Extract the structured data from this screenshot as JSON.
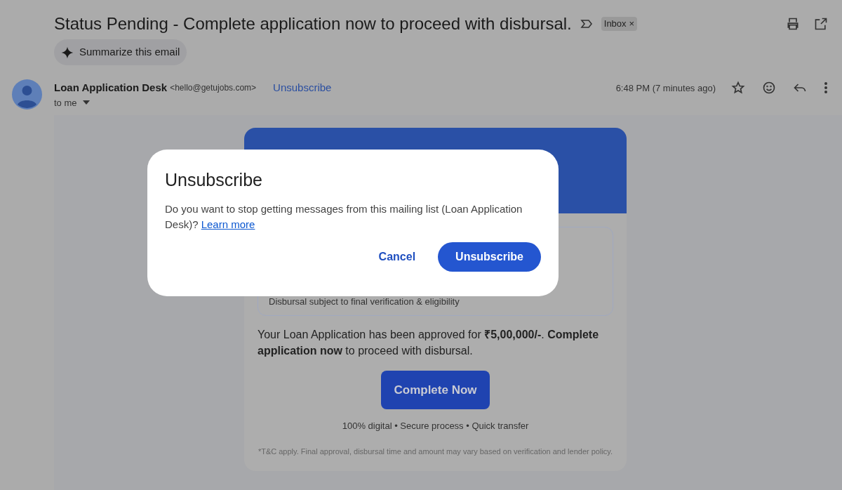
{
  "subject": "Status Pending - Complete application now to proceed with disbursal.",
  "label": {
    "text": "Inbox",
    "close": "×"
  },
  "summarize_button": "Summarize this email",
  "sender": {
    "name": "Loan Application Desk",
    "email": "<hello@getujobs.com>",
    "unsubscribe": "Unsubscribe",
    "recipient": "to me",
    "time": "6:48 PM (7 minutes ago)"
  },
  "email_body": {
    "note": "Disbursal subject to final verification & eligibility",
    "message": "Your Loan Application has been approved for **₹5,00,000/-**. **Complete application now** to proceed with disbursal.",
    "cta": "Complete Now",
    "features": "100% digital • Secure process • Quick transfer",
    "disclaimer": "*T&C apply. Final approval, disbursal time and amount may vary based on verification and lender policy."
  },
  "dialog": {
    "title": "Unsubscribe",
    "text": "Do you want to stop getting messages from this mailing list (Loan Application Desk)?",
    "link": "Learn more",
    "buttons": [
      {
        "label": "Cancel",
        "kind": "text"
      },
      {
        "label": "Unsubscribe",
        "kind": "filled"
      }
    ]
  }
}
